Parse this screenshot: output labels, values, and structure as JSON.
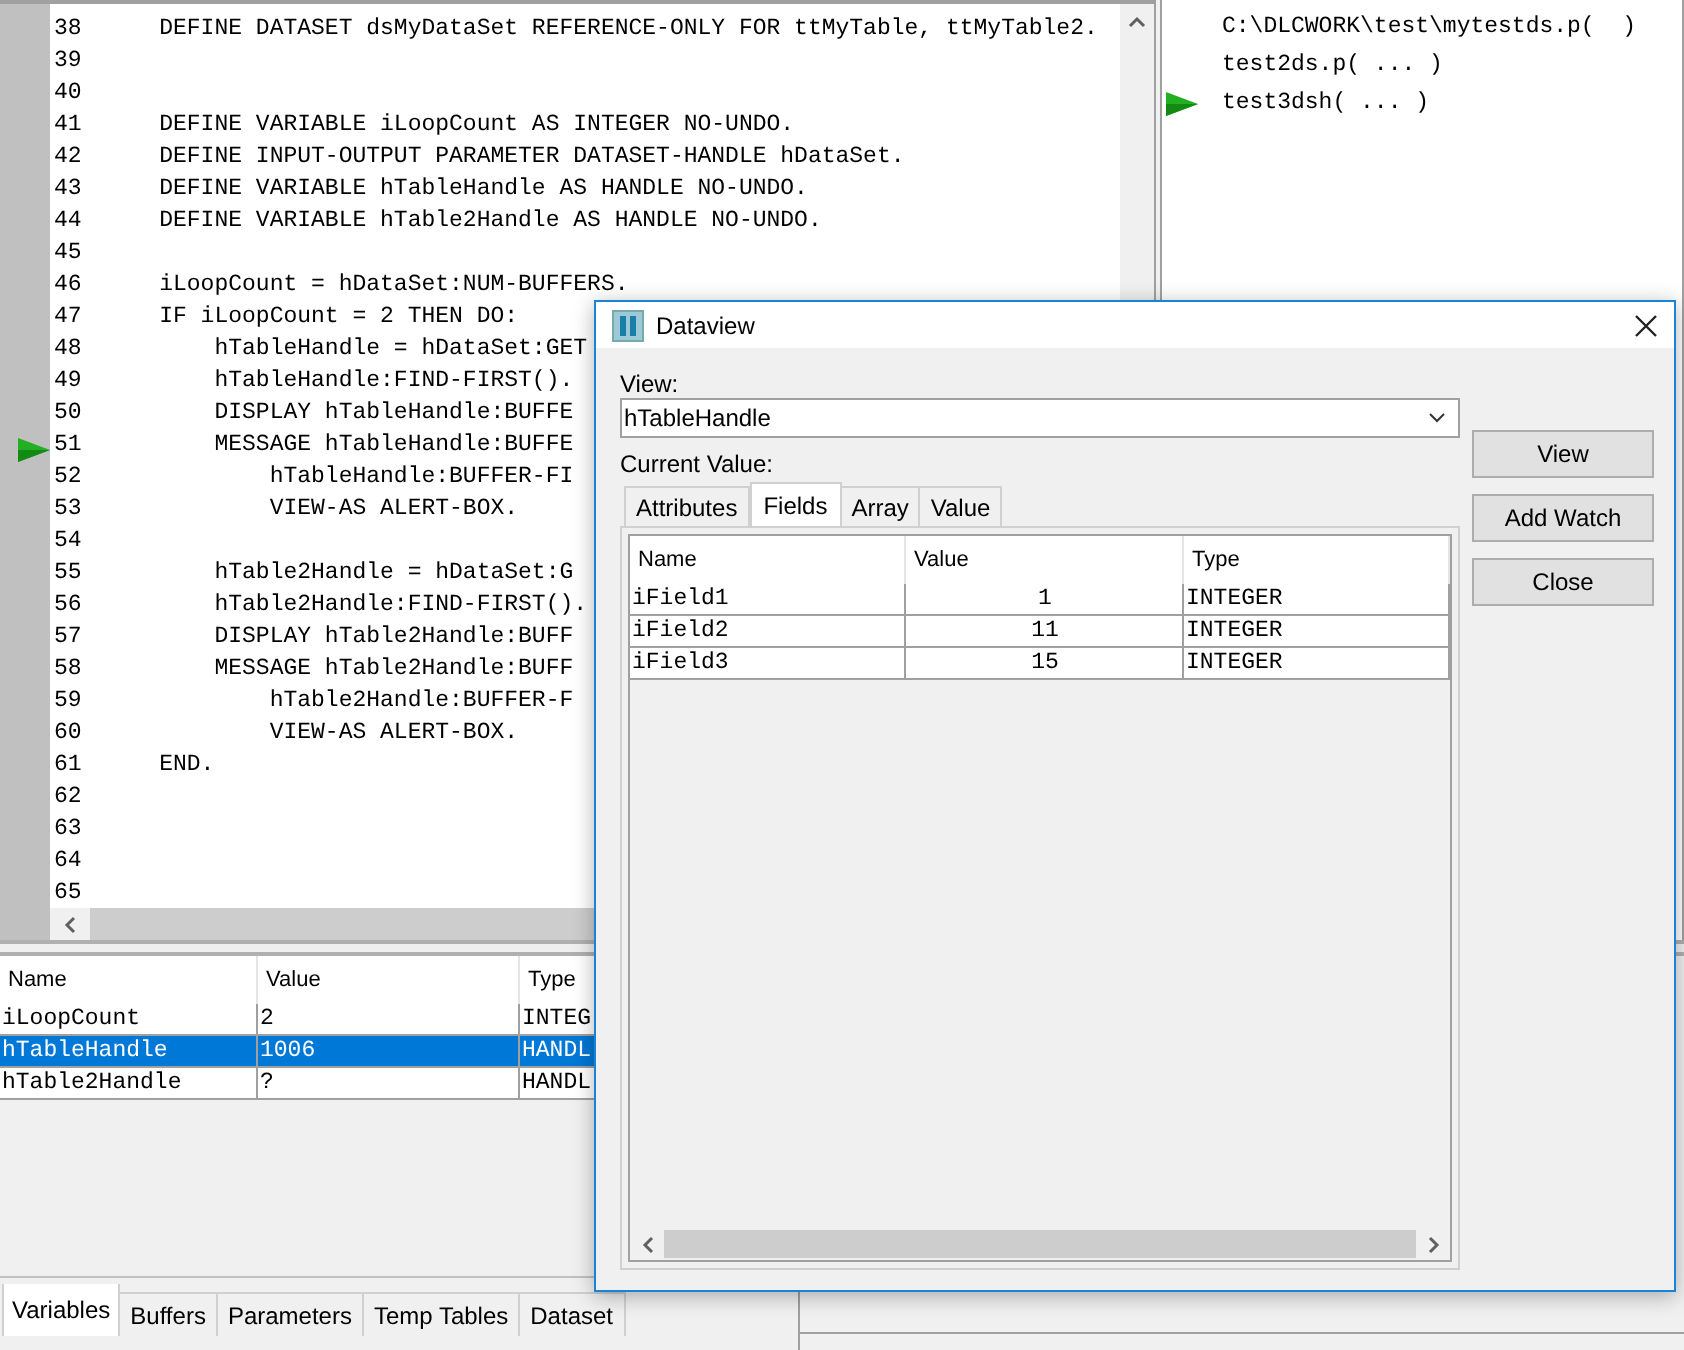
{
  "editor": {
    "lines": [
      {
        "number": "38",
        "text": "    DEFINE DATASET dsMyDataSet REFERENCE-ONLY FOR ttMyTable, ttMyTable2.",
        "current": false
      },
      {
        "number": "39",
        "current": false
      },
      {
        "number": "40",
        "current": false
      },
      {
        "number": "41",
        "text": "    DEFINE VARIABLE iLoopCount AS INTEGER NO-UNDO.",
        "current": false
      },
      {
        "number": "42",
        "text": "    DEFINE INPUT-OUTPUT PARAMETER DATASET-HANDLE hDataSet.",
        "current": false
      },
      {
        "number": "43",
        "text": "    DEFINE VARIABLE hTableHandle AS HANDLE NO-UNDO.",
        "current": false
      },
      {
        "number": "44",
        "text": "    DEFINE VARIABLE hTable2Handle AS HANDLE NO-UNDO.",
        "current": false
      },
      {
        "number": "45",
        "current": false
      },
      {
        "number": "46",
        "text": "    iLoopCount = hDataSet:NUM-BUFFERS.",
        "current": false
      },
      {
        "number": "47",
        "text": "    IF iLoopCount = 2 THEN DO:",
        "current": false
      },
      {
        "number": "48",
        "text": "        hTableHandle = hDataSet:GET",
        "current": false
      },
      {
        "number": "49",
        "text": "        hTableHandle:FIND-FIRST().",
        "current": false
      },
      {
        "number": "50",
        "text": "        DISPLAY hTableHandle:BUFFE",
        "current": false
      },
      {
        "number": "51",
        "text": "        MESSAGE hTableHandle:BUFFE",
        "current": true
      },
      {
        "number": "52",
        "text": "            hTableHandle:BUFFER-FI",
        "current": false
      },
      {
        "number": "53",
        "text": "            VIEW-AS ALERT-BOX.",
        "current": false
      },
      {
        "number": "54",
        "current": false
      },
      {
        "number": "55",
        "text": "        hTable2Handle = hDataSet:G",
        "current": false
      },
      {
        "number": "56",
        "text": "        hTable2Handle:FIND-FIRST().",
        "current": false
      },
      {
        "number": "57",
        "text": "        DISPLAY hTable2Handle:BUFF",
        "current": false
      },
      {
        "number": "58",
        "text": "        MESSAGE hTable2Handle:BUFF",
        "current": false
      },
      {
        "number": "59",
        "text": "            hTable2Handle:BUFFER-F",
        "current": false
      },
      {
        "number": "60",
        "text": "            VIEW-AS ALERT-BOX.",
        "current": false
      },
      {
        "number": "61",
        "text": "    END.",
        "current": false
      },
      {
        "number": "62",
        "current": false
      },
      {
        "number": "63",
        "current": false
      },
      {
        "number": "64",
        "current": false
      },
      {
        "number": "65",
        "current": false
      }
    ]
  },
  "call_stack": [
    {
      "text": "C:\\DLCWORK\\test\\mytestds.p(  )",
      "current": false
    },
    {
      "text": "test2ds.p( ... )",
      "current": false
    },
    {
      "text": "test3dsh( ... )",
      "current": true
    }
  ],
  "variables": {
    "columns": [
      "Name",
      "Value",
      "Type"
    ],
    "rows": [
      {
        "cells": [
          "iLoopCount",
          "2",
          "INTEG"
        ],
        "selected": false
      },
      {
        "cells": [
          "hTableHandle",
          "1006",
          "HANDL"
        ],
        "selected": true
      },
      {
        "cells": [
          "hTable2Handle",
          "?",
          "HANDL"
        ],
        "selected": false
      }
    ]
  },
  "bottom_tabs": [
    {
      "label": "Variables",
      "selected": true
    },
    {
      "label": "Buffers",
      "selected": false
    },
    {
      "label": "Parameters",
      "selected": false
    },
    {
      "label": "Temp Tables",
      "selected": false
    },
    {
      "label": "Dataset",
      "selected": false
    }
  ],
  "dialog": {
    "title": "Dataview",
    "view_label": "View:",
    "view_value": "hTableHandle",
    "current_value_label": "Current Value:",
    "tabs": [
      {
        "label": "Attributes",
        "selected": false
      },
      {
        "label": "Fields",
        "selected": true
      },
      {
        "label": "Array",
        "selected": false
      },
      {
        "label": "Value",
        "selected": false
      }
    ],
    "table": {
      "columns": [
        "Name",
        "Value",
        "Type"
      ],
      "rows": [
        {
          "cells": [
            "iField1",
            "1",
            "INTEGER"
          ]
        },
        {
          "cells": [
            "iField2",
            "11",
            "INTEGER"
          ]
        },
        {
          "cells": [
            "iField3",
            "15",
            "INTEGER"
          ]
        }
      ]
    },
    "buttons": [
      "View",
      "Add Watch",
      "Close"
    ]
  }
}
